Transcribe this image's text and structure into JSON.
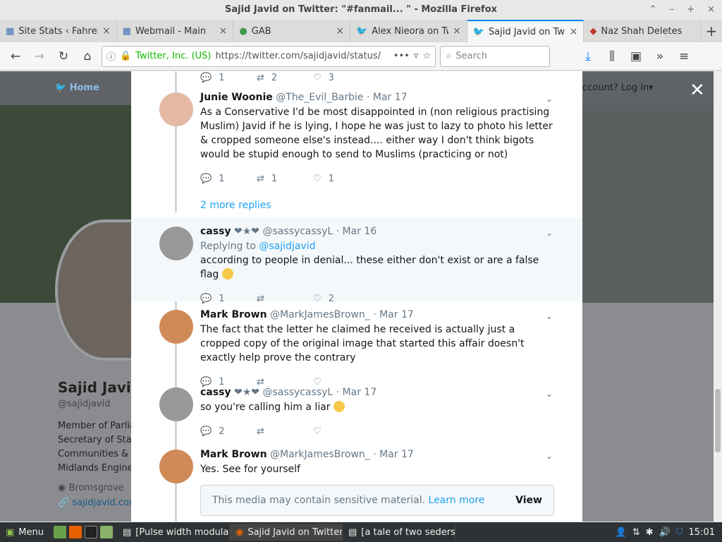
{
  "window": {
    "title": "Sajid Javid on Twitter: \"#fanmail... \" - Mozilla Firefox"
  },
  "tabs": [
    {
      "label": "Site Stats ‹ Fahrenh",
      "icon": "grid-icon"
    },
    {
      "label": "Webmail - Main",
      "icon": "grid-icon"
    },
    {
      "label": "GAB",
      "icon": "frog-icon"
    },
    {
      "label": "Alex Nieora on Twit",
      "icon": "twitter-icon"
    },
    {
      "label": "Sajid Javid on Twitte",
      "icon": "twitter-icon",
      "active": true
    },
    {
      "label": "Naz Shah Deletes",
      "icon": "flag-icon"
    }
  ],
  "nav": {
    "identity": "Twitter, Inc. (US)",
    "url": "https://twitter.com/sajidjavid/status/",
    "search_placeholder": "Search"
  },
  "twitter": {
    "home": "Home",
    "login": "ccount? Log in▾"
  },
  "profile": {
    "name": "Sajid Javid",
    "handle": "@sajidjavid",
    "bio": [
      "Member of Parlia",
      "Secretary of Stat",
      "Communities & L",
      "Midlands Engine"
    ],
    "location": "Bromsgrove",
    "link": "sajidjavid.com"
  },
  "top_actions": {
    "replies": "1",
    "retweets": "2",
    "likes": "3"
  },
  "tweets": [
    {
      "name": "Junie Woonie",
      "handle": "@The_Evil_Barbie",
      "date": "· Mar 17",
      "text": "As a Conservative I'd be most disappointed in (non religious practising Muslim) Javid if he is lying, I hope he was just to lazy to photo his letter & cropped someone else's instead.... either way I don't think bigots would be stupid enough to send to Muslims (practicing or not)",
      "replies": "1",
      "retweets": "1",
      "likes": "1"
    },
    {
      "name": "cassy",
      "handle": "@sassycassyL",
      "date": "· Mar 16",
      "replying_prefix": "Replying to",
      "replying_to": "@sajidjavid",
      "text": "according to people in denial... these either don't exist or are a false flag",
      "replies": "1",
      "retweets": "",
      "likes": "2"
    },
    {
      "name": "Mark Brown",
      "handle": "@MarkJamesBrown_",
      "date": "· Mar 17",
      "text": "The fact that the letter he claimed he received is actually just a cropped copy of the original image that started this affair doesn't exactly help prove the contrary",
      "replies": "1",
      "retweets": "",
      "likes": ""
    },
    {
      "name": "cassy",
      "handle": "@sassycassyL",
      "date": "· Mar 17",
      "text": "so you're calling him a liar",
      "replies": "2",
      "retweets": "",
      "likes": ""
    },
    {
      "name": "Mark Brown",
      "handle": "@MarkJamesBrown_",
      "date": "· Mar 17",
      "text": "Yes. See for yourself",
      "media_text": "This media may contain sensitive material.",
      "media_link": "Learn more",
      "media_view": "View"
    }
  ],
  "more_replies": "2 more replies",
  "taskbar": {
    "menu": "Menu",
    "tasks": [
      "[Pulse width modulati...",
      "Sajid Javid on Twitter:...",
      "[a tale of two seders...."
    ],
    "clock": "15:01"
  }
}
